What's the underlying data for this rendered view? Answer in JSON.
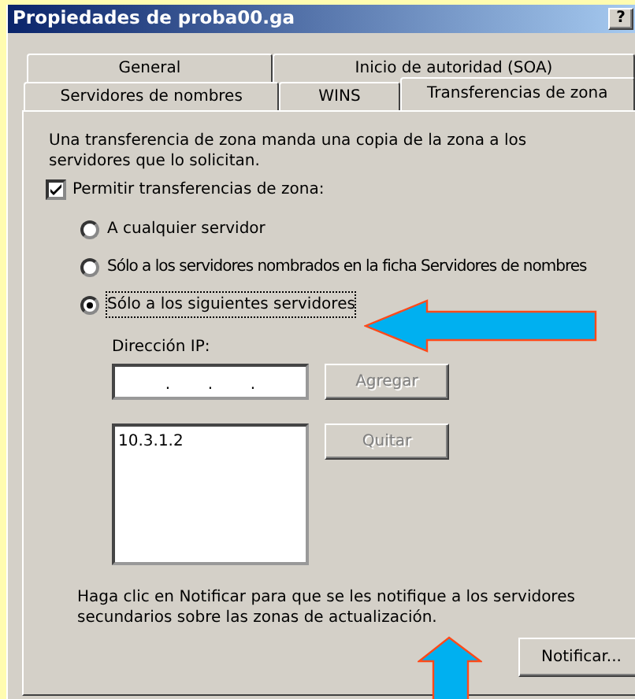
{
  "window": {
    "title": "Propiedades de proba00.ga",
    "help_button": "?"
  },
  "tab_rows": [
    [
      {
        "label": "General",
        "selected": false
      },
      {
        "label": "Inicio de autoridad (SOA)",
        "selected": false
      }
    ],
    [
      {
        "label": "Servidores de nombres",
        "selected": false
      },
      {
        "label": "WINS",
        "selected": false
      },
      {
        "label": "Transferencias de zona",
        "selected": true
      }
    ]
  ],
  "description": "Una transferencia de zona manda una copia de la zona a los servidores que lo solicitan.",
  "allow_transfers": {
    "label": "Permitir transferencias de zona:",
    "checked": true
  },
  "options": [
    {
      "label": "A cualquier servidor",
      "selected": false,
      "focused": false
    },
    {
      "label": "Sólo a los servidores nombrados en la ficha Servidores de nombres",
      "selected": false,
      "focused": false
    },
    {
      "label": "Sólo a los siguientes servidores",
      "selected": true,
      "focused": true
    }
  ],
  "ip_address": {
    "label": "Dirección IP:",
    "separators": [
      ".",
      ".",
      "."
    ]
  },
  "add_button": {
    "label": "Agregar",
    "disabled": true
  },
  "server_list": [
    "10.3.1.2"
  ],
  "remove_button": {
    "label": "Quitar",
    "disabled": true
  },
  "notify_text": "Haga clic en Notificar para que se les notifique a los servidores secundarios sobre las zonas de actualización.",
  "notify_button": {
    "label": "Notificar...",
    "disabled": false
  }
}
